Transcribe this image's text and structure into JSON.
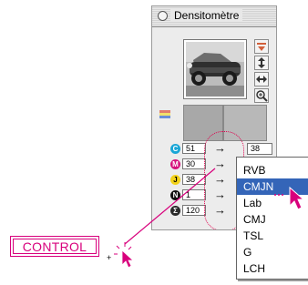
{
  "window": {
    "title": "Densitomètre"
  },
  "channels": [
    {
      "letter": "C",
      "value": "51",
      "color": "#1aa6d6"
    },
    {
      "letter": "M",
      "value": "30",
      "color": "#d6127d"
    },
    {
      "letter": "J",
      "value": "38",
      "color": "#f2d21a"
    },
    {
      "letter": "N",
      "value": "1",
      "color": "#111111"
    },
    {
      "letter": "Σ",
      "value": "120",
      "color": "#2a2a2a"
    }
  ],
  "output_value": "38",
  "menu": {
    "items": [
      "RVB",
      "CMJN",
      "Lab",
      "CMJ",
      "TSL",
      "G",
      "LCH"
    ],
    "selected": "CMJN"
  },
  "control_key": {
    "label": "CONTROL"
  },
  "plus_sign": "+",
  "colors": {
    "accent": "#d8007c",
    "selection": "#3465b8"
  },
  "icons": [
    "close-box-icon",
    "triangle-icon",
    "up-down-arrows-icon",
    "left-right-arrows-icon",
    "zoom-icon",
    "color-swatch-icon",
    "right-arrow-icon",
    "mouse-pointer-icon",
    "click-burst-icon"
  ]
}
